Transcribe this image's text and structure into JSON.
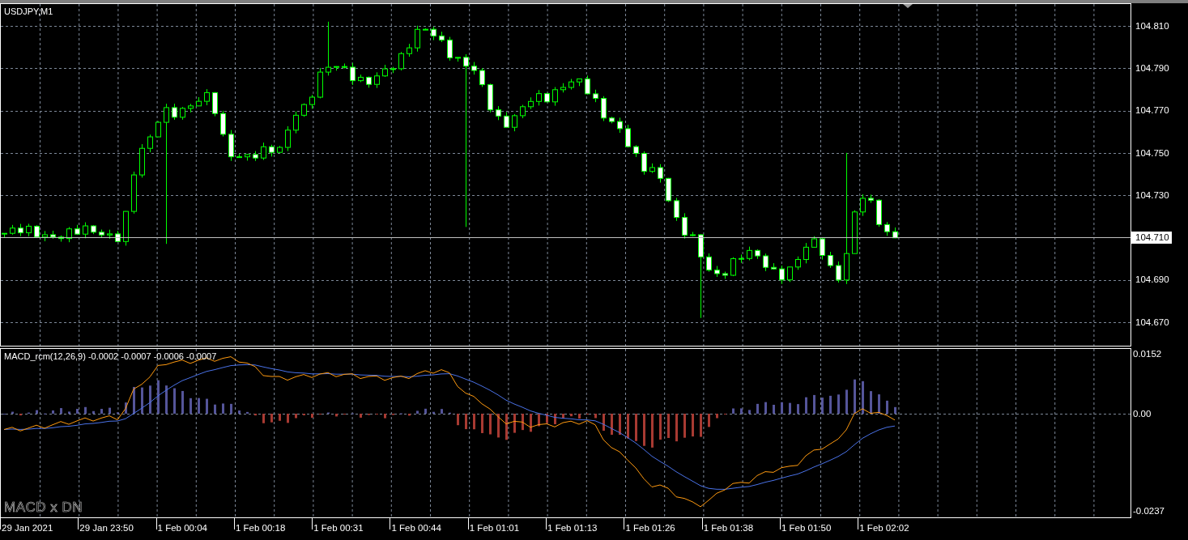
{
  "main_chart": {
    "title": "USDJPY,M1",
    "price_axis": [
      {
        "text": "104.810",
        "current": false
      },
      {
        "text": "104.790",
        "current": false
      },
      {
        "text": "104.770",
        "current": false
      },
      {
        "text": "104.750",
        "current": false
      },
      {
        "text": "104.730",
        "current": false
      },
      {
        "text": "104.710",
        "current": true
      },
      {
        "text": "104.690",
        "current": false
      },
      {
        "text": "104.670",
        "current": false
      }
    ]
  },
  "indicator": {
    "label": "MACD_rcm(12,26,9) -0.0002 -0.0007 -0.0006 -0.0007",
    "caption": "MACD x DN",
    "axis": [
      "0.0152",
      "0.00",
      "-0.0237"
    ]
  },
  "time_axis": [
    "29 Jan 2021",
    "29 Jan 23:50",
    "1 Feb 00:04",
    "1 Feb 00:18",
    "1 Feb 00:31",
    "1 Feb 00:44",
    "1 Feb 01:01",
    "1 Feb 01:13",
    "1 Feb 01:26",
    "1 Feb 01:38",
    "1 Feb 01:50",
    "1 Feb 02:02"
  ]
}
